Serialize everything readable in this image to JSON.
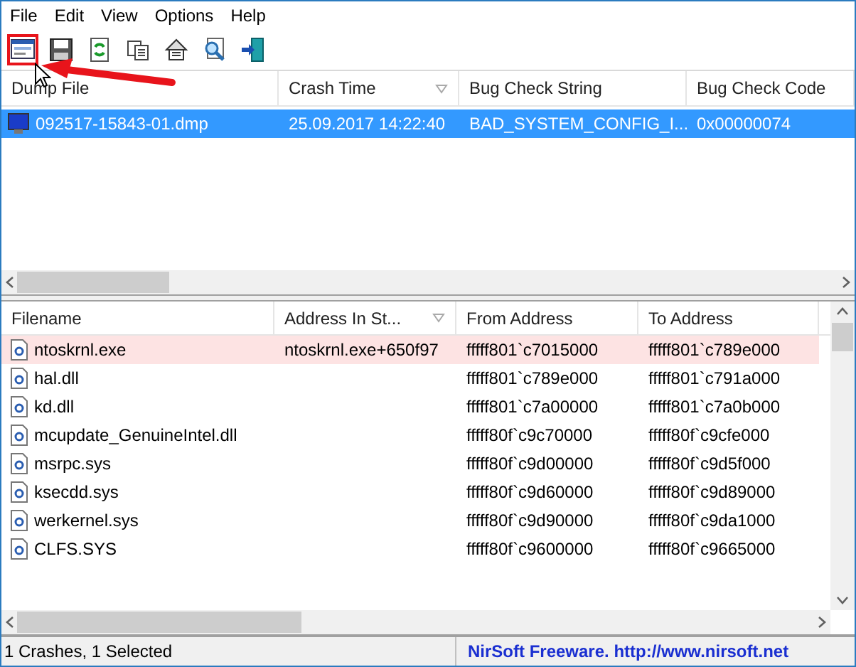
{
  "menu": [
    "File",
    "Edit",
    "View",
    "Options",
    "Help"
  ],
  "toolbar": [
    {
      "kind": "properties",
      "highlighted": true
    },
    {
      "kind": "save",
      "highlighted": false
    },
    {
      "kind": "refresh",
      "highlighted": false
    },
    {
      "kind": "copy",
      "highlighted": false
    },
    {
      "kind": "options",
      "highlighted": false
    },
    {
      "kind": "find",
      "highlighted": false
    },
    {
      "kind": "exit",
      "highlighted": false
    }
  ],
  "crash_table": {
    "columns": [
      {
        "label": "Dump File",
        "sorted": false
      },
      {
        "label": "Crash Time",
        "sorted": true
      },
      {
        "label": "Bug Check String",
        "sorted": false
      },
      {
        "label": "Bug Check Code",
        "sorted": false
      }
    ],
    "rows": [
      {
        "selected": true,
        "cells": [
          "092517-15843-01.dmp",
          "25.09.2017 14:22:40",
          "BAD_SYSTEM_CONFIG_I...",
          "0x00000074"
        ]
      }
    ]
  },
  "driver_table": {
    "columns": [
      {
        "label": "Filename",
        "sorted": false
      },
      {
        "label": "Address In St...",
        "sorted": true
      },
      {
        "label": "From Address",
        "sorted": false
      },
      {
        "label": "To Address",
        "sorted": false
      }
    ],
    "rows": [
      {
        "highlighted": true,
        "cells": [
          "ntoskrnl.exe",
          "ntoskrnl.exe+650f97",
          "fffff801`c7015000",
          "fffff801`c789e000"
        ]
      },
      {
        "highlighted": false,
        "cells": [
          "hal.dll",
          "",
          "fffff801`c789e000",
          "fffff801`c791a000"
        ]
      },
      {
        "highlighted": false,
        "cells": [
          "kd.dll",
          "",
          "fffff801`c7a00000",
          "fffff801`c7a0b000"
        ]
      },
      {
        "highlighted": false,
        "cells": [
          "mcupdate_GenuineIntel.dll",
          "",
          "fffff80f`c9c70000",
          "fffff80f`c9cfe000"
        ]
      },
      {
        "highlighted": false,
        "cells": [
          "msrpc.sys",
          "",
          "fffff80f`c9d00000",
          "fffff80f`c9d5f000"
        ]
      },
      {
        "highlighted": false,
        "cells": [
          "ksecdd.sys",
          "",
          "fffff80f`c9d60000",
          "fffff80f`c9d89000"
        ]
      },
      {
        "highlighted": false,
        "cells": [
          "werkernel.sys",
          "",
          "fffff80f`c9d90000",
          "fffff80f`c9da1000"
        ]
      },
      {
        "highlighted": false,
        "cells": [
          "CLFS.SYS",
          "",
          "fffff80f`c9600000",
          "fffff80f`c9665000"
        ]
      }
    ]
  },
  "status_bar": {
    "count": "1 Crashes, 1 Selected",
    "credit": "NirSoft Freeware.  http://www.nirsoft.net"
  }
}
